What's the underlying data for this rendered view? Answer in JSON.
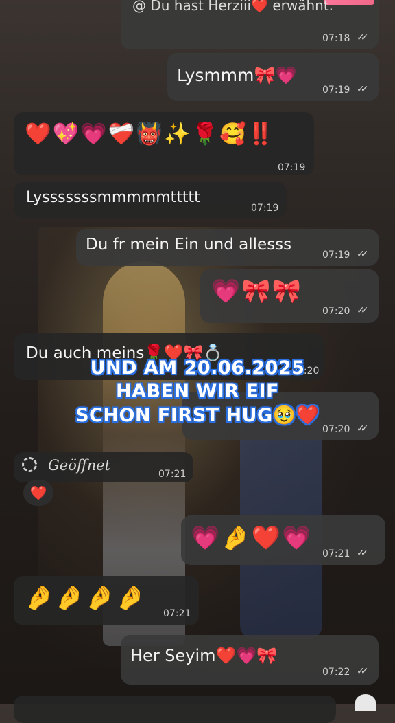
{
  "messages": [
    {
      "id": "m0",
      "text": "@ Du hast Herziii❤️ erwähnt.",
      "time": "07:18",
      "ticks": "✓✓"
    },
    {
      "id": "m1",
      "text": "Lysmmm🎀💗",
      "time": "07:19",
      "ticks": "✓✓"
    },
    {
      "id": "m2",
      "text": "❤️💖💗❤️‍🩹👹✨🌹🥰‼️",
      "time": "07:19"
    },
    {
      "id": "m3",
      "text": "Lysssssssmmmmmttttt",
      "time": "07:19"
    },
    {
      "id": "m4",
      "text": "Du fr mein Ein und allesss",
      "time": "07:19",
      "ticks": "✓✓"
    },
    {
      "id": "m5",
      "text": "💗🎀🎀",
      "time": "07:20",
      "ticks": "✓✓"
    },
    {
      "id": "m6",
      "text": "Du auch meins🌹❤️🎀💍",
      "time": "07:20"
    },
    {
      "id": "m7",
      "text": "",
      "time": "07:20",
      "ticks": "✓✓"
    },
    {
      "id": "m8",
      "opened_label": "Geöffnet",
      "time": "07:21",
      "reaction": "❤️"
    },
    {
      "id": "m9",
      "text": "💗🤌❤️💗",
      "time": "07:21",
      "ticks": "✓✓"
    },
    {
      "id": "m10",
      "text": "🤌🤌🤌🤌",
      "time": "07:21"
    },
    {
      "id": "m11",
      "text": "Her Seyim❤️💗🎀",
      "time": "07:22",
      "ticks": "✓✓"
    }
  ],
  "overlay": {
    "line1": "UND AM 20.06.2025",
    "line2": "HABEN WIR EIF",
    "line3": "SCHON FIRST HUG🥹❤️"
  },
  "colors": {
    "bubble_out": "#3a3a3a",
    "bubble_in": "#262626",
    "overlay_outline": "#2a6fe0"
  }
}
